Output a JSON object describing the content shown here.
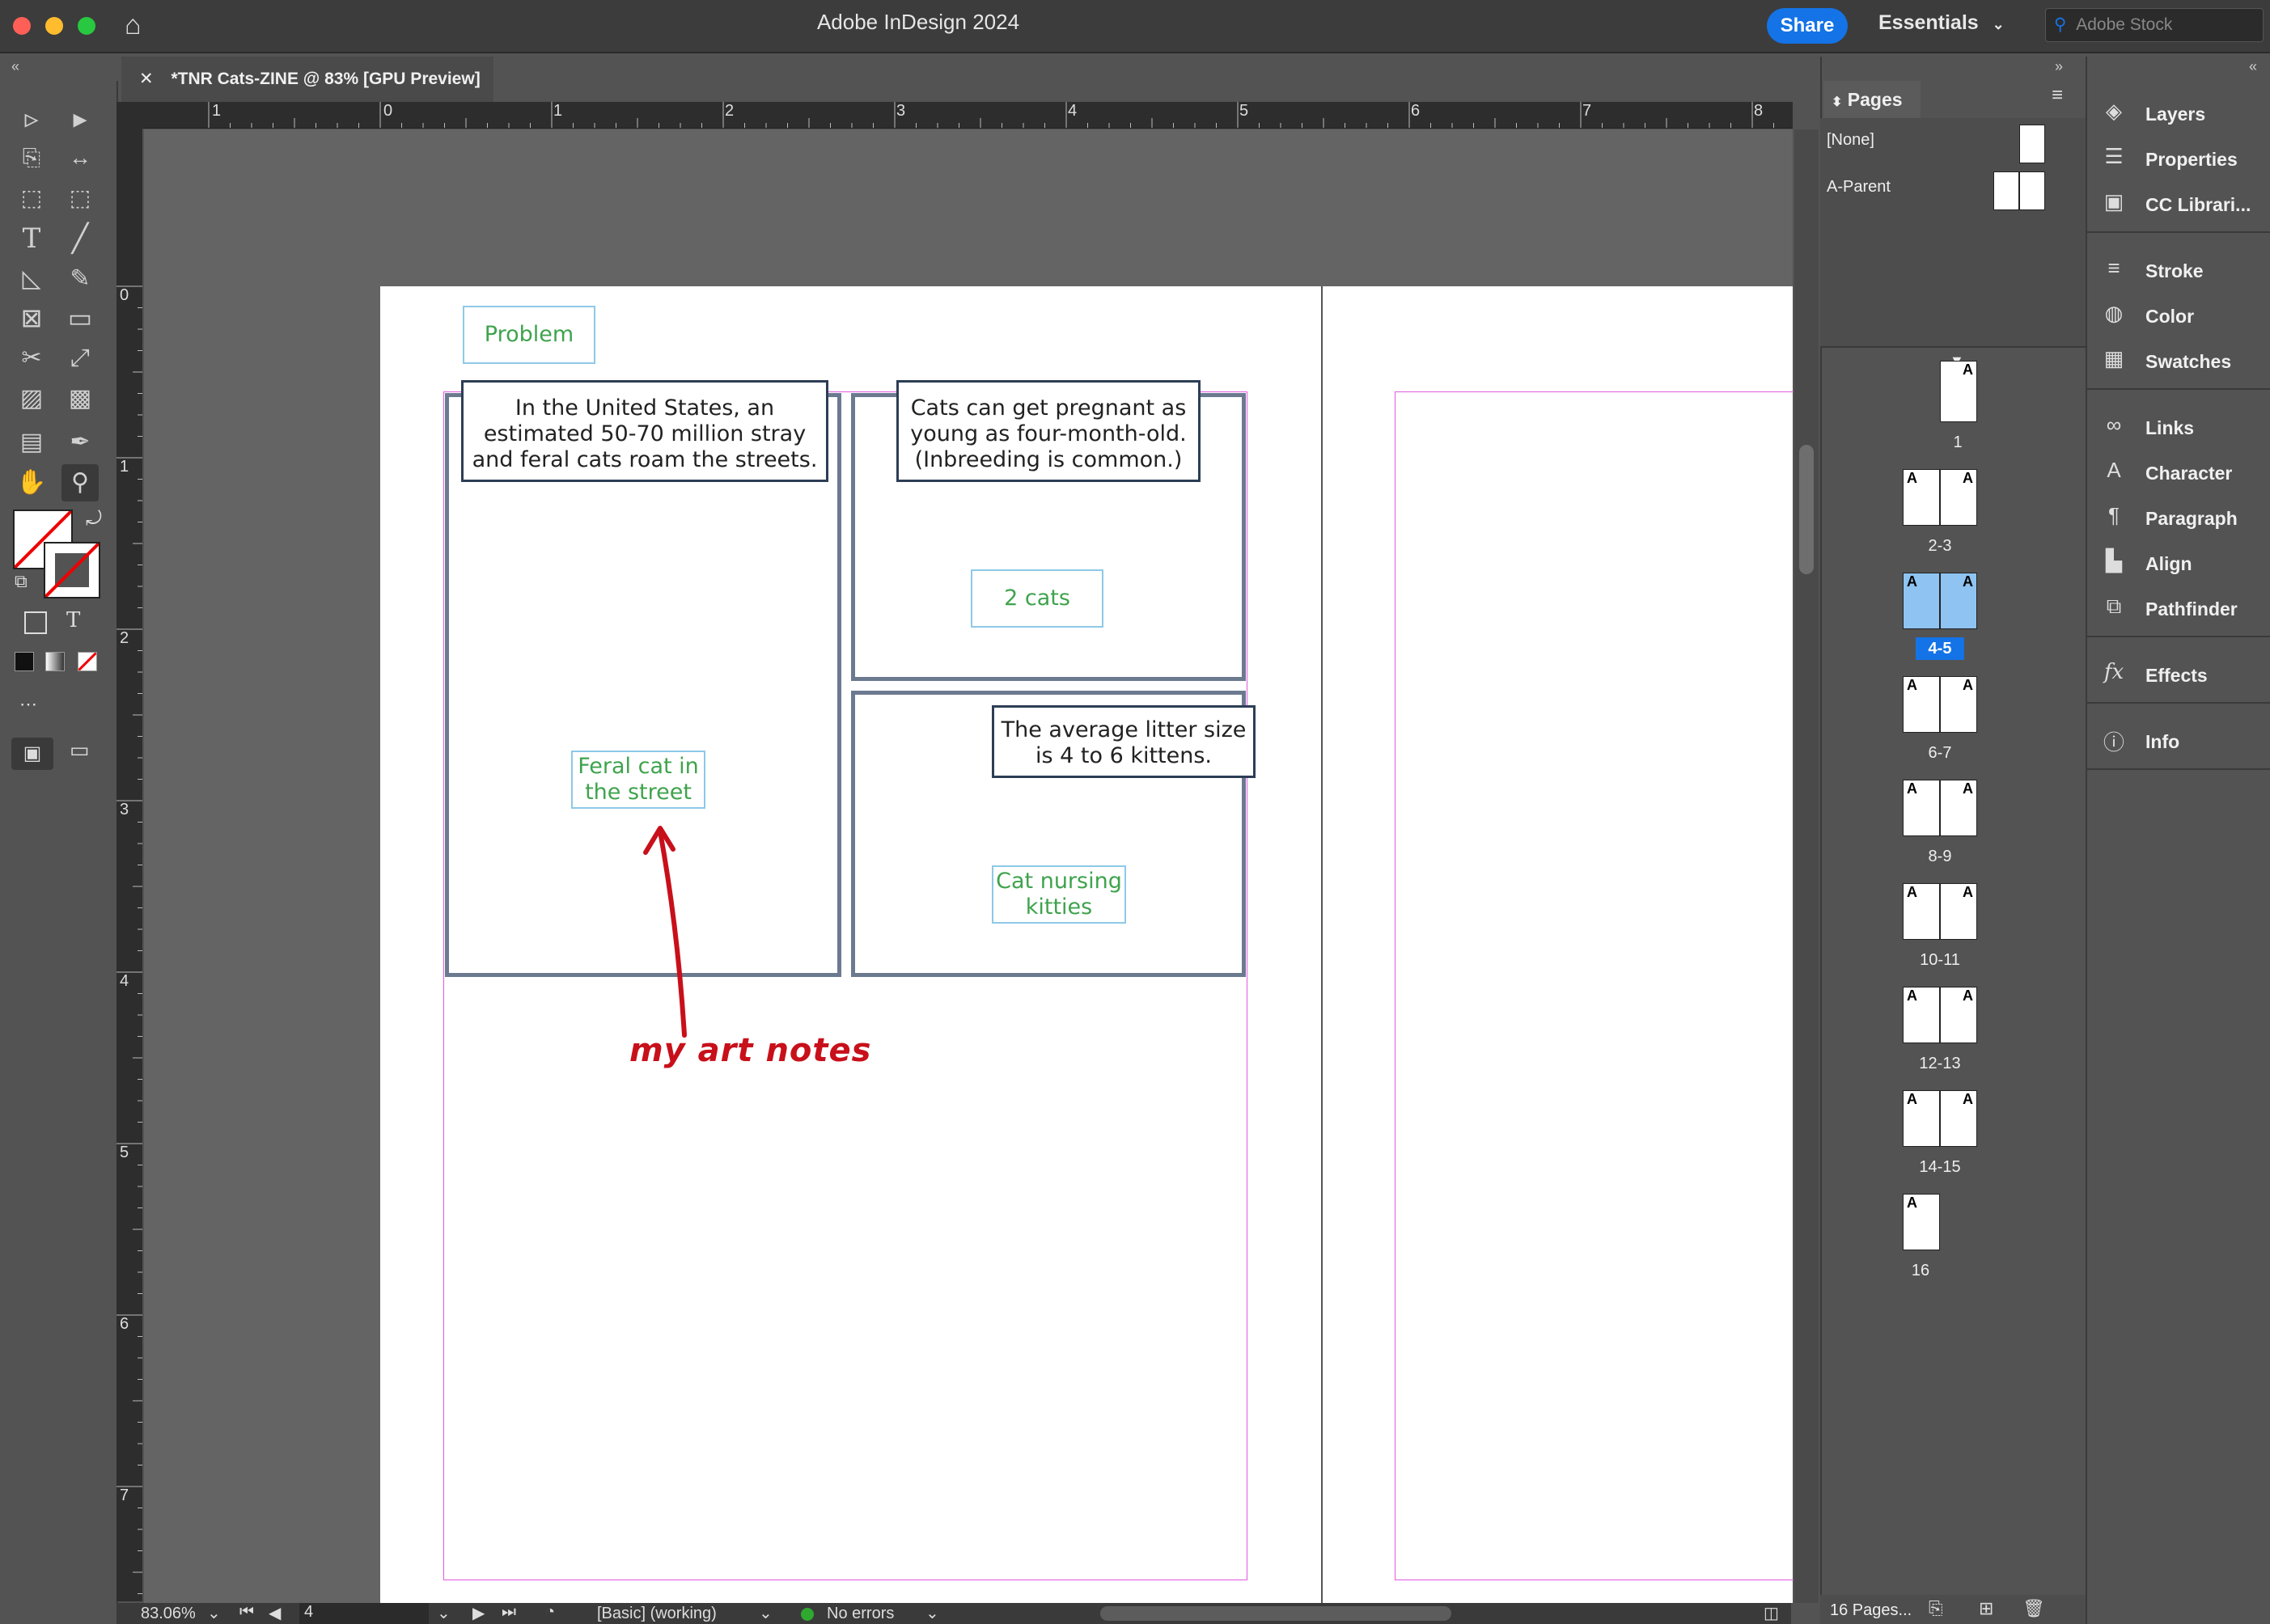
{
  "window": {
    "title": "Adobe InDesign 2024"
  },
  "header": {
    "share_label": "Share",
    "workspace": "Essentials",
    "stock_placeholder": "Adobe Stock"
  },
  "document_tab": {
    "label": "*TNR Cats-ZINE @ 83% [GPU Preview]"
  },
  "ruler": {
    "horizontal": [
      "1",
      "0",
      "1",
      "2",
      "3",
      "4",
      "5",
      "6",
      "7",
      "8"
    ],
    "vertical": [
      "0",
      "1",
      "2",
      "3",
      "4",
      "5",
      "6",
      "7"
    ]
  },
  "spread": {
    "label_problem": "Problem",
    "text1": "In the United States, an estimated 50-70 million stray and feral cats roam the streets.",
    "text2": "Cats can get pregnant as young as four-month-old. (Inbreeding is common.)",
    "label_2cats": "2 cats",
    "text3": "The average litter size is 4 to 6 kittens.",
    "label_feral": "Feral cat in the street",
    "label_nursing": "Cat nursing kitties",
    "handwritten": "my art notes"
  },
  "status_bar": {
    "zoom": "83.06%",
    "page": "4",
    "style": "[Basic] (working)",
    "errors": "No errors"
  },
  "pages_panel": {
    "title": "Pages",
    "parents": [
      "[None]",
      "A-Parent"
    ],
    "pages": [
      "1",
      "2-3",
      "4-5",
      "6-7",
      "8-9",
      "10-11",
      "12-13",
      "14-15",
      "16"
    ],
    "footer": "16 Pages..."
  },
  "right_panels": {
    "group1": [
      "Layers",
      "Properties",
      "CC Librari..."
    ],
    "group2": [
      "Stroke",
      "Color",
      "Swatches"
    ],
    "group3": [
      "Links",
      "Character",
      "Paragraph",
      "Align",
      "Pathfinder"
    ],
    "group4": [
      "Effects"
    ],
    "group5": [
      "Info"
    ]
  },
  "colors": {
    "accent": "#1473e6",
    "note_red": "#c8101a",
    "label_green": "#3fa34d",
    "margin_magenta": "#e05ae0"
  }
}
